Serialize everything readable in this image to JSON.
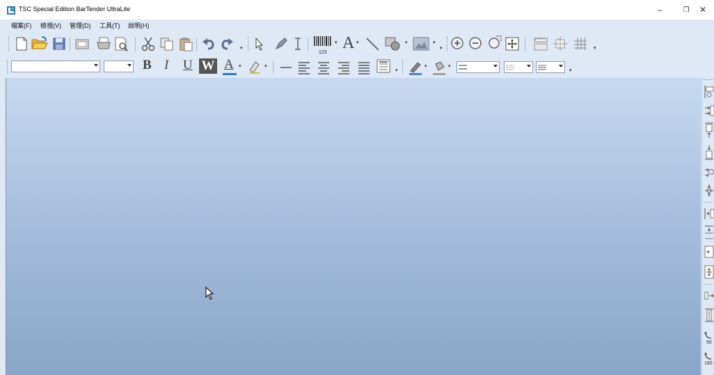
{
  "window": {
    "title": "TSC Special Edition BarTender UltraLite",
    "controls": {
      "minimize": "–",
      "restore": "❐",
      "close": "✕"
    }
  },
  "menubar": {
    "items": [
      {
        "label": "檔案(F)"
      },
      {
        "label": "檢視(V)"
      },
      {
        "label": "管理(D)"
      },
      {
        "label": "工具(T)"
      },
      {
        "label": "說明(H)"
      }
    ]
  },
  "toolbar": {
    "barcode_digits": "123",
    "font_letter": "A",
    "icons": [
      "new-document-icon",
      "open-folder-icon",
      "save-icon",
      "page-setup-icon",
      "print-icon",
      "print-preview-icon",
      "cut-icon",
      "copy-icon",
      "paste-icon",
      "undo-icon",
      "redo-icon",
      "select-arrow-icon",
      "pen-tool-icon",
      "text-cursor-icon",
      "barcode-icon",
      "text-tool-icon",
      "line-tool-icon",
      "shape-tool-icon",
      "picture-tool-icon",
      "zoom-in-icon",
      "zoom-out-icon",
      "zoom-fit-icon",
      "zoom-full-icon",
      "ruler-icon",
      "guide-icon",
      "grid-icon"
    ]
  },
  "format_toolbar": {
    "bold": "B",
    "italic": "I",
    "underline": "U",
    "reverse": "W",
    "font_color_letter": "A",
    "font_name_value": "",
    "font_size_value": ""
  },
  "right_panel": {
    "rotate_90": "90",
    "rotate_180": "180"
  },
  "colors": {
    "accent": "#2b78c8",
    "background": "#dfe8f5",
    "canvas_top": "#c6d9ef",
    "canvas_bottom": "#8aa5c7"
  }
}
